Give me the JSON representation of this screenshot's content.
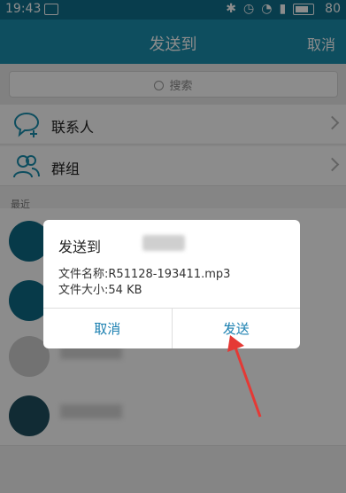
{
  "status_bar": {
    "time": "19:43",
    "battery": "80"
  },
  "header": {
    "title": "发送到",
    "cancel_label": "取消"
  },
  "search": {
    "placeholder": "搜索"
  },
  "rows": [
    {
      "label": "联系人",
      "icon": "chat-bubble-plus-icon"
    },
    {
      "label": "群组",
      "icon": "group-icon"
    }
  ],
  "recent_section_label": "最近",
  "dialog": {
    "title": "发送到",
    "file_name_label": "文件名称:",
    "file_name": "R51128-193411.mp3",
    "file_size_label": "文件大小:",
    "file_size": "54 KB",
    "cancel_label": "取消",
    "send_label": "发送"
  },
  "colors": {
    "header": "#1b8fae",
    "accent": "#1a7fb0",
    "arrow": "#e53935"
  }
}
